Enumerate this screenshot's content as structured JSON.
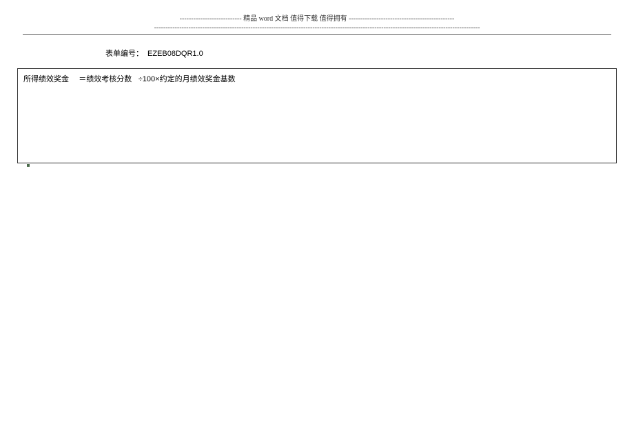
{
  "header": {
    "line1_prefix": "---------------------------",
    "line1_mid": " 精品 word 文档  值得下载  值得拥有 ",
    "line1_suffix": "----------------------------------------------",
    "line2": "----------------------------------------------------------------------------------------------------------------------------------------------"
  },
  "form": {
    "id_label": "表单编号：",
    "id_value": "EZEB08DQR1.0"
  },
  "content": {
    "formula_p1": "所得绩效奖金",
    "formula_p2": "＝绩效考核分数",
    "formula_p3": "÷100×约定的月绩效奖金基数"
  }
}
